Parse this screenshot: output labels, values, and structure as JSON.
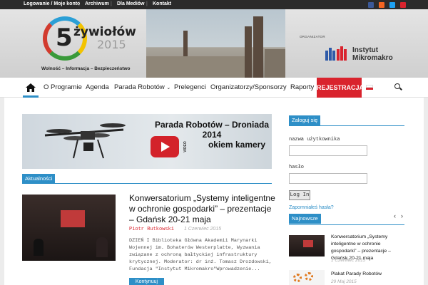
{
  "topbar": {
    "links": [
      "Logowanie / Moje konto",
      "Archiwum",
      "Dla Mediów",
      "Kontakt"
    ],
    "social": [
      {
        "icon": "facebook-icon",
        "color": "#3b5998"
      },
      {
        "icon": "rss-icon",
        "color": "#f26522"
      },
      {
        "icon": "twitter-icon",
        "color": "#1da1f2"
      },
      {
        "icon": "youtube-icon",
        "color": "#d9232d"
      }
    ]
  },
  "header": {
    "logo_digit": "5",
    "logo_title": "żywiołów",
    "logo_year": "2015",
    "tagline": "Wolność – Informacja – Bezpieczeństwo",
    "organizer_label": "ORGANIZATOR",
    "organizer_line1": "Instytut",
    "organizer_line2": "Mikromakro"
  },
  "nav": {
    "items": [
      "O Programie",
      "Agenda",
      "Parada Robotów",
      "Prelegenci",
      "Organizatorzy/Sponsorzy",
      "Raporty"
    ],
    "register": "REJESTRACJA",
    "accent": "#2e8fc7",
    "register_color": "#d9232d"
  },
  "banner": {
    "title_line1": "Parada Robotów – Droniada",
    "title_line2": "2014",
    "title_line3": "okiem kamery",
    "video_tag": "VIDEO"
  },
  "news": {
    "section_label": "Aktualności",
    "article": {
      "title": "Konwersatorium „Systemy inteligentne w ochronie gospodarki” – prezentacje – Gdańsk 20-21 maja",
      "author": "Piotr Rutkowski",
      "date": "1 Czerwiec 2015",
      "excerpt": "DZIEŃ I Biblioteka Główna Akademii Marynarki Wojennej im. Bohaterów Westerplatte, Wyzwania związane z ochroną bałtyckiej infrastruktury krytycznej. Moderator: dr inż. Tomasz Drozdowski, Fundacja \"Instytut Mikromakro\"Wprowadzenie...",
      "more": "Kontynuuj"
    }
  },
  "sidebar": {
    "login_label": "Zaloguj się",
    "username_label": "nazwa użytkownika",
    "password_label": "hasło",
    "login_button": "Log In",
    "forgot": "Zapomniałeś hasła?",
    "newest_label": "Najnowsze",
    "posts": [
      {
        "title": "Konwersatorium „Systemy inteligentne w ochronie gospodarki” – prezentacje – Gdańsk 20-21 maja",
        "date": "1 Czerwiec 2015"
      },
      {
        "title": "Plakat Parady Robotów",
        "date": "29 Maj 2015"
      }
    ]
  }
}
